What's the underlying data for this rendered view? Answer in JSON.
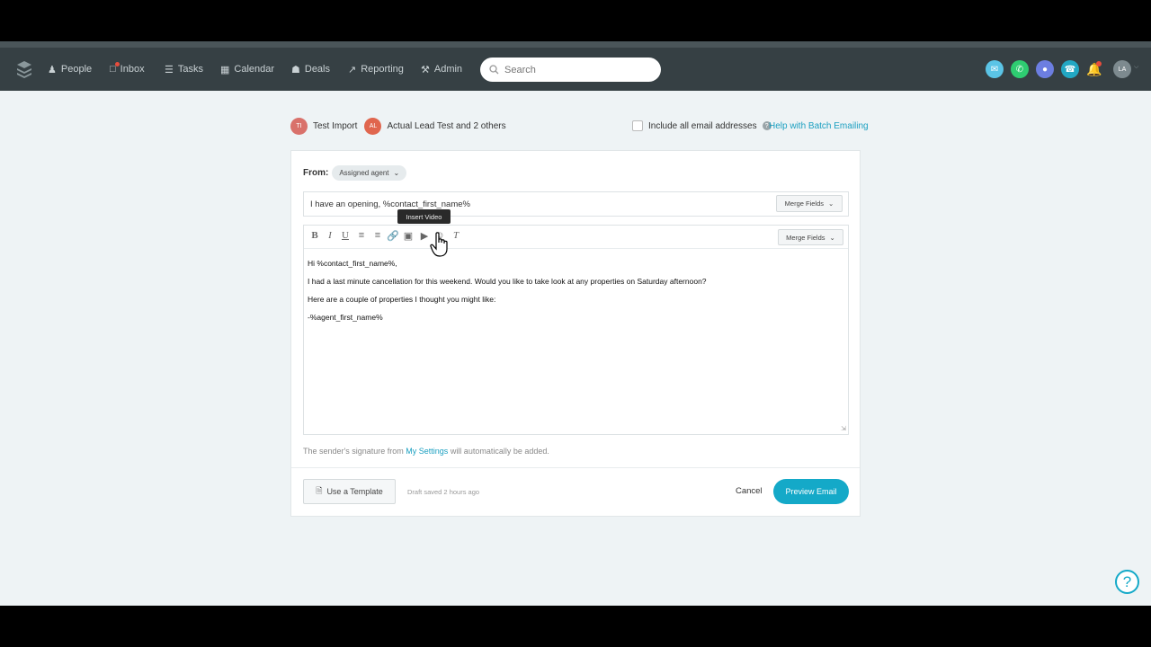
{
  "nav": {
    "items": [
      {
        "label": "People",
        "icon": "person-icon"
      },
      {
        "label": "Inbox",
        "icon": "inbox-icon"
      },
      {
        "label": "Tasks",
        "icon": "tasks-icon"
      },
      {
        "label": "Calendar",
        "icon": "calendar-icon"
      },
      {
        "label": "Deals",
        "icon": "deals-icon"
      },
      {
        "label": "Reporting",
        "icon": "reporting-icon"
      },
      {
        "label": "Admin",
        "icon": "admin-icon"
      }
    ],
    "search_placeholder": "Search",
    "avatar_initials": "LA",
    "colors": {
      "email": "#5bc4e6",
      "phone": "#2ecc71",
      "chat": "#6c7ee1",
      "call": "#22a7c3",
      "notif_dot": "#e74c3c"
    }
  },
  "recipients": {
    "first": {
      "initials": "TI",
      "name": "Test Import",
      "color": "#d9716b"
    },
    "second": {
      "initials": "AL",
      "name": "Actual Lead Test and 2 others",
      "color": "#e0664e"
    }
  },
  "include_all": "Include all email addresses",
  "help_batch": "Help with Batch Emailing",
  "compose": {
    "from_label": "From:",
    "from_value": "Assigned agent",
    "subject": "I have an opening, %contact_first_name%",
    "merge_fields": "Merge Fields",
    "tooltip": "Insert Video",
    "body": {
      "line1": "Hi %contact_first_name%,",
      "line2": "I had a last minute cancellation for this weekend. Would you like to take look at any properties on Saturday afternoon?",
      "line3": "Here are a couple of properties I thought you might like:",
      "line4": "-%agent_first_name%"
    },
    "signature_prefix": "The sender's signature from ",
    "signature_link": "My Settings",
    "signature_suffix": " will automatically be added.",
    "use_template": "Use a Template",
    "draft_status": "Draft saved 2 hours ago",
    "cancel": "Cancel",
    "preview": "Preview Email"
  },
  "help_icon": "?"
}
